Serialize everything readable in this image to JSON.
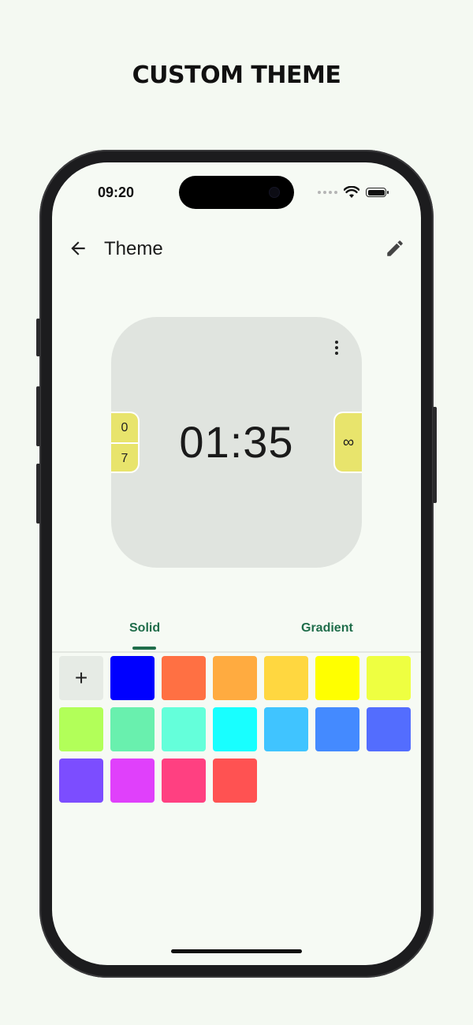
{
  "headline": {
    "word1": "CUSTOM",
    "word2": "THEME"
  },
  "status": {
    "time": "09:20"
  },
  "appbar": {
    "title": "Theme"
  },
  "preview": {
    "clock": "01:35",
    "left_counter_top": "0",
    "left_counter_bottom": "7",
    "right_counter": "∞"
  },
  "tabs": [
    {
      "label": "Solid",
      "selected": true
    },
    {
      "label": "Gradient",
      "selected": false
    }
  ],
  "add_label": "+",
  "swatches": [
    [
      "#0000ff",
      "#ff7043",
      "#ffab40",
      "#ffd740",
      "#ffff00",
      "#eeff41"
    ],
    [
      "#b2ff59",
      "#69f0ae",
      "#64ffda",
      "#18ffff",
      "#40c4ff",
      "#448aff",
      "#536dfe"
    ],
    [
      "#7c4dff",
      "#e040fb",
      "#ff4081",
      "#ff5252"
    ]
  ],
  "colors": {
    "accent": "#1f6d4a",
    "counter_bg": "#e8e46c",
    "preview_bg": "#e0e4df"
  }
}
